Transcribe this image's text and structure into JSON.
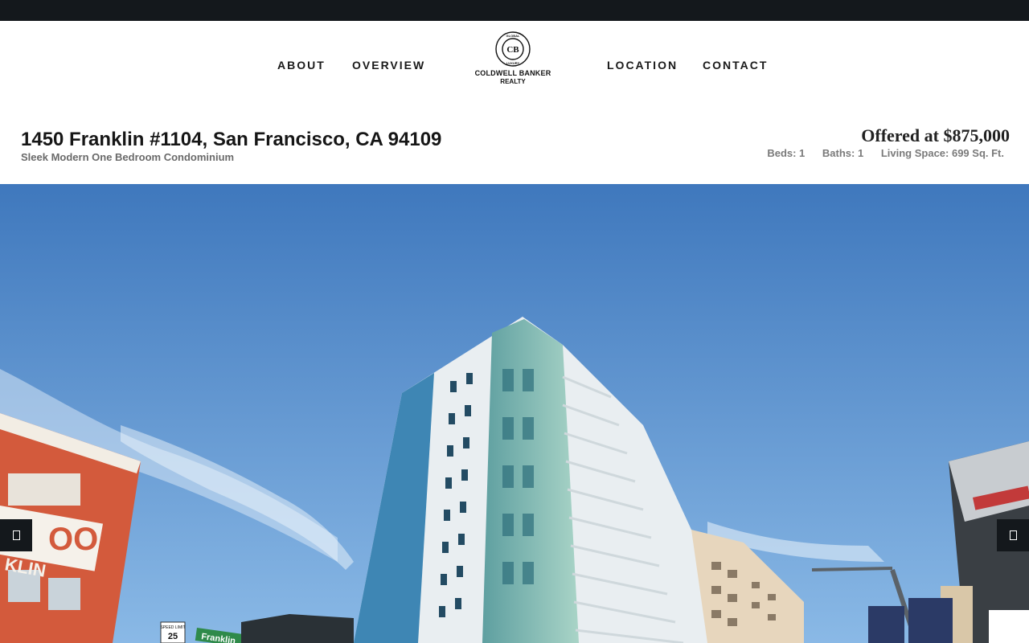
{
  "nav": {
    "about": "ABOUT",
    "overview": "OVERVIEW",
    "location": "LOCATION",
    "contact": "CONTACT"
  },
  "logo": {
    "line1": "COLDWELL BANKER",
    "line2": "REALTY",
    "ring_text": "GLOBAL LUXURY",
    "monogram": "CB"
  },
  "listing": {
    "address": "1450 Franklin #1104, San Francisco, CA 94109",
    "subtitle": "Sleek Modern One Bedroom Condominium",
    "price": "Offered at $875,000",
    "beds": "Beds: 1",
    "baths": "Baths: 1",
    "living_space": "Living Space: 699 Sq. Ft."
  },
  "hero": {
    "sign_text_1": "OO",
    "sign_text_2": "KLIN",
    "street_sign": "Franklin",
    "speed_limit": "25",
    "speed_label": "SPEED LIMIT"
  },
  "slider": {
    "prev_icon": "chevron-left-icon",
    "next_icon": "chevron-right-icon"
  },
  "colors": {
    "topbar": "#14181c",
    "sky_top": "#3f78bd",
    "sky_bottom": "#8ab9e6",
    "text_dark": "#161616",
    "text_muted": "#6a6a6a"
  }
}
